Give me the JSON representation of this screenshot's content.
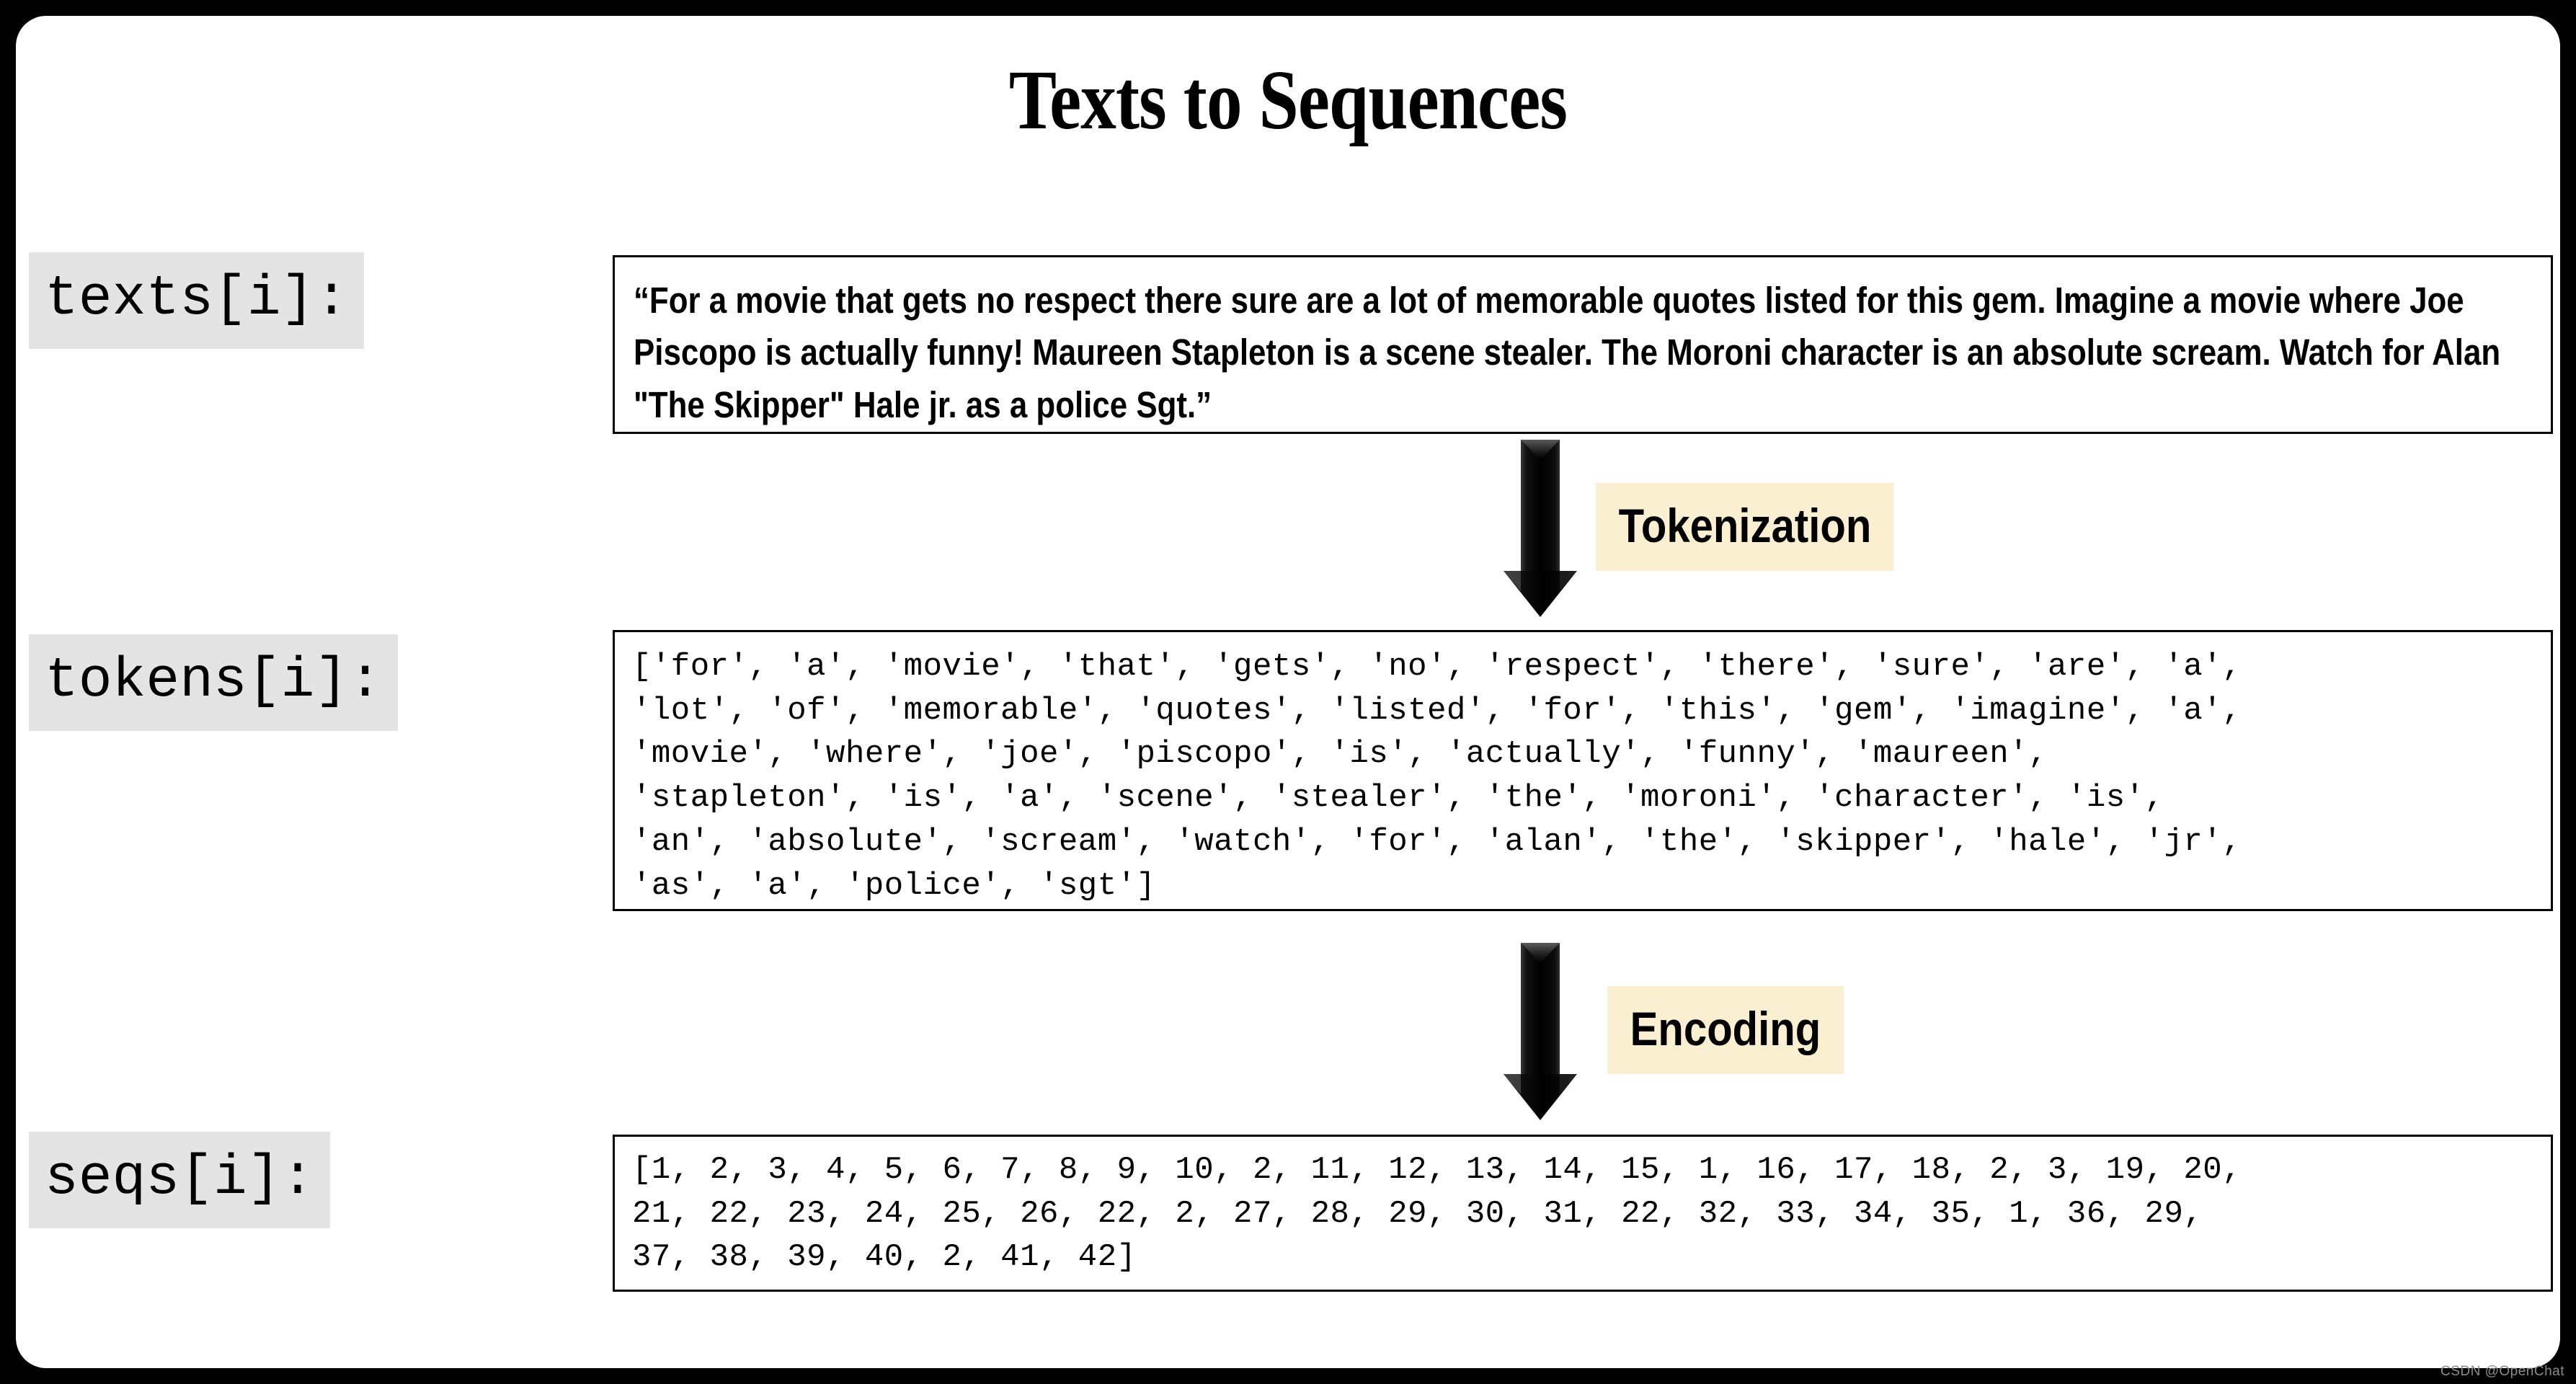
{
  "slide": {
    "title": "Texts to Sequences",
    "background_color": "#FFFFFF",
    "frame_color": "#000000",
    "label_background": "#E4E4E4",
    "tag_background": "#FBEFD2"
  },
  "rows": {
    "texts": {
      "label": "texts[i]:",
      "content": "“For a movie that gets no respect there sure are a lot of memorable quotes listed for this gem. Imagine a movie where Joe Piscopo is actually funny! Maureen Stapleton is a scene stealer. The Moroni character is an absolute scream. Watch for Alan \"The Skipper\" Hale jr. as a police Sgt.”"
    },
    "tokens": {
      "label": "tokens[i]:",
      "content": "['for', 'a', 'movie', 'that', 'gets', 'no', 'respect', 'there', 'sure', 'are', 'a',\n'lot', 'of', 'memorable', 'quotes', 'listed', 'for', 'this', 'gem', 'imagine', 'a',\n'movie', 'where', 'joe', 'piscopo', 'is', 'actually', 'funny', 'maureen',\n'stapleton', 'is', 'a', 'scene', 'stealer', 'the', 'moroni', 'character', 'is',\n'an', 'absolute', 'scream', 'watch', 'for', 'alan', 'the', 'skipper', 'hale', 'jr',\n'as', 'a', 'police', 'sgt']"
    },
    "seqs": {
      "label": "seqs[i]:",
      "content": "[1, 2, 3, 4, 5, 6, 7, 8, 9, 10, 2, 11, 12, 13, 14, 15, 1, 16, 17, 18, 2, 3, 19, 20,\n21, 22, 23, 24, 25, 26, 22, 2, 27, 28, 29, 30, 31, 22, 32, 33, 34, 35, 1, 36, 29,\n37, 38, 39, 40, 2, 41, 42]"
    }
  },
  "steps": {
    "tokenization": {
      "label": "Tokenization",
      "arrow": "down-arrow-icon"
    },
    "encoding": {
      "label": "Encoding",
      "arrow": "down-arrow-icon"
    }
  },
  "watermark": {
    "text": "CSDN @OpenChat"
  }
}
